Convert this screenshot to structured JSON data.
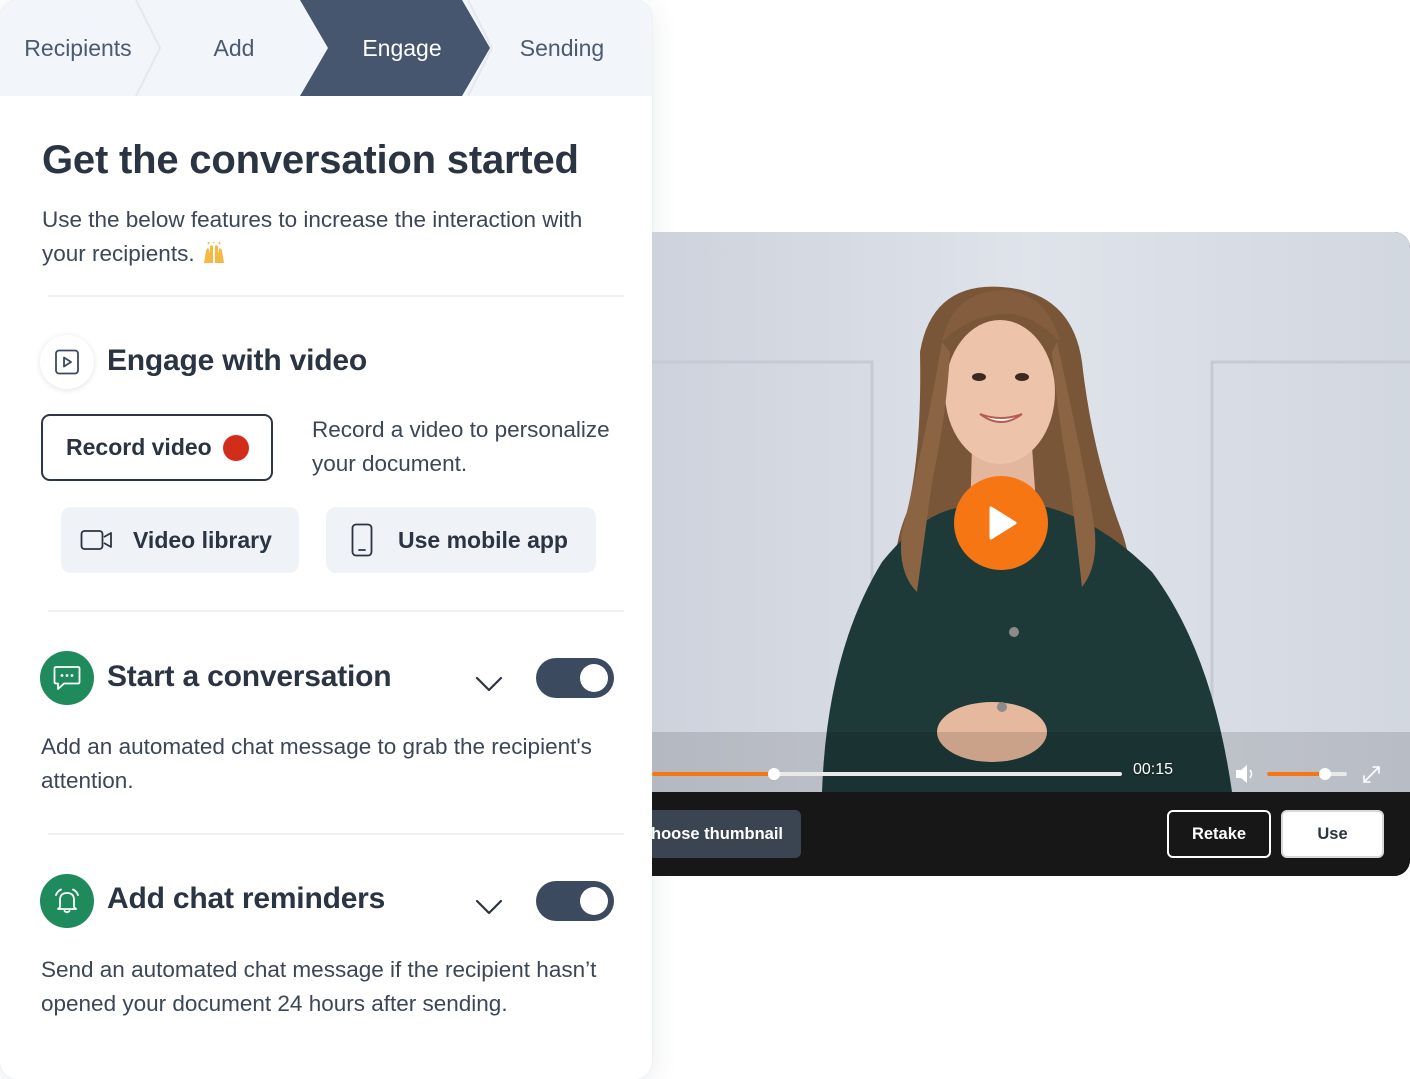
{
  "steps": [
    {
      "label": "Recipients",
      "active": false
    },
    {
      "label": "Add",
      "active": false
    },
    {
      "label": "Engage",
      "active": true
    },
    {
      "label": "Sending",
      "active": false
    }
  ],
  "header": {
    "title": "Get the conversation started",
    "subtitle": "Use the below features to increase the interaction with your recipients.",
    "subtitle_emoji": "raising-hands-emoji"
  },
  "video_section": {
    "icon": "video-file-icon",
    "title": "Engage with video",
    "record_label": "Record video",
    "record_description": "Record a video to personalize your document.",
    "library_label": "Video library",
    "mobile_label": "Use mobile app"
  },
  "conversation_section": {
    "icon": "chat-bubble-icon",
    "title": "Start a conversation",
    "enabled": true,
    "description": "Add an automated chat message to grab the recipient's attention."
  },
  "reminders_section": {
    "icon": "alarm-bell-icon",
    "title": "Add chat reminders",
    "enabled": true,
    "description": "Send an automated chat message if the recipient hasn’t opened your document 24 hours after sending."
  },
  "player": {
    "time": "00:15",
    "progress": 0.2,
    "volume": 0.72,
    "choose_thumbnail_label": "Choose thumbnail",
    "retake_label": "Retake",
    "use_label": "Use",
    "accent_color": "#f57613"
  },
  "colors": {
    "active_step": "#45566e",
    "toggle_on": "#3b4a5f",
    "green_icon": "#1f8a5b",
    "record_dot": "#d12d1a"
  }
}
